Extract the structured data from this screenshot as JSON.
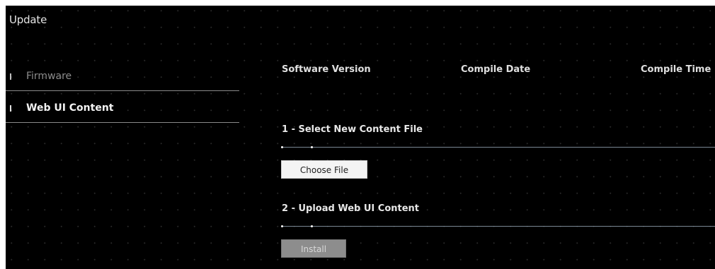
{
  "page": {
    "title": "Update"
  },
  "sidebar": {
    "items": [
      {
        "label": "Firmware",
        "state": "inactive"
      },
      {
        "label": "Web UI Content",
        "state": "active"
      }
    ]
  },
  "info_header": {
    "software_version_label": "Software Version",
    "compile_date_label": "Compile Date",
    "compile_time_label": "Compile Time"
  },
  "steps": {
    "select": {
      "title": "1 - Select New Content File",
      "button_label": "Choose File"
    },
    "upload": {
      "title": "2 - Upload Web UI Content",
      "button_label": "Install",
      "button_enabled": false
    }
  },
  "colors": {
    "background": "#000000",
    "divider": "#7a8794",
    "active_text": "#f2f2f2",
    "inactive_text": "#8c8c8c",
    "disabled_button": "#8d8d8d"
  }
}
